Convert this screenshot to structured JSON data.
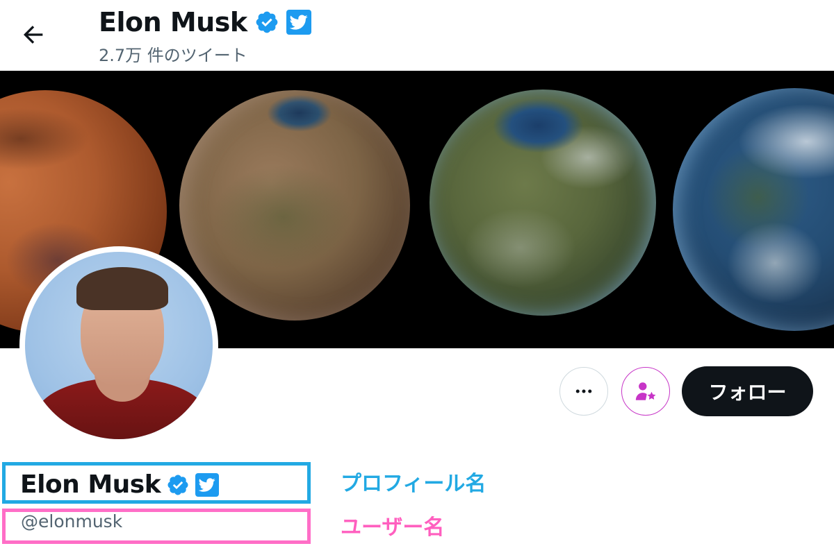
{
  "header": {
    "back_icon": "arrow-left-icon",
    "title": "Elon Musk",
    "tweet_count": "2.7万 件のツイート"
  },
  "banner": {
    "description_icons": [
      "mars-planet",
      "terraforming-planet",
      "terraforming-planet-2",
      "earth-like-planet"
    ]
  },
  "profile": {
    "display_name": "Elon Musk",
    "handle": "@elonmusk",
    "verified_icon": "verified-badge-icon",
    "twitter_badge_icon": "twitter-bird-icon"
  },
  "actions": {
    "more_icon": "more-dots-icon",
    "notify_icon": "person-star-icon",
    "follow_label": "フォロー"
  },
  "annotations": {
    "profile_name_label": "プロフィール名",
    "user_name_label": "ユーザー名",
    "profile_name_color": "#22a9e3",
    "user_name_color": "#ff6ec7"
  },
  "colors": {
    "verified": "#1d9bf0",
    "follow_bg": "#0f1419",
    "notify_accent": "#c735c7"
  }
}
